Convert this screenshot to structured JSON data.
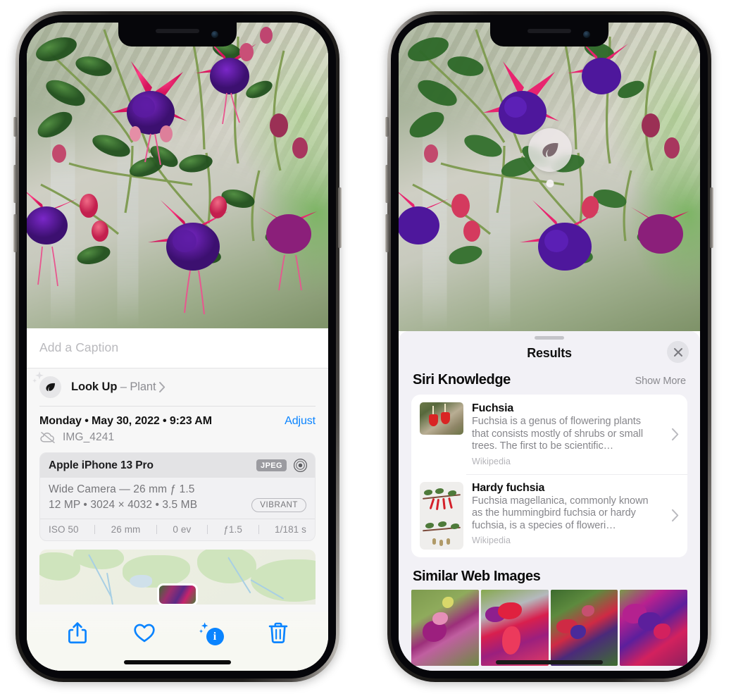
{
  "left_phone": {
    "caption_placeholder": "Add a Caption",
    "lookup": {
      "label": "Look Up",
      "separator": " – ",
      "subject": "Plant",
      "icon": "leaf-icon",
      "sparkle_icon": "sparkle-icon",
      "chevron_icon": "chevron-right-icon"
    },
    "meta": {
      "date": "Monday • May 30, 2022 • 9:23 AM",
      "adjust_label": "Adjust",
      "filename": "IMG_4241",
      "cloud_icon": "cloud-slash-icon"
    },
    "camera_card": {
      "device": "Apple iPhone 13 Pro",
      "format_badge": "JPEG",
      "aperture_icon": "aperture-icon",
      "lens_line": "Wide Camera — 26 mm ƒ 1.5",
      "specs_line": "12 MP • 3024 × 4032 • 3.5 MB",
      "style_pill": "VIBRANT",
      "exif": [
        "ISO 50",
        "26 mm",
        "0 ev",
        "ƒ1.5",
        "1/181 s"
      ]
    },
    "toolbar": [
      {
        "name": "share-button",
        "icon": "share-icon"
      },
      {
        "name": "favorite-button",
        "icon": "heart-icon"
      },
      {
        "name": "info-button",
        "icon": "info-sparkle-icon",
        "glyph": "i"
      },
      {
        "name": "delete-button",
        "icon": "trash-icon"
      }
    ],
    "accent_color": "#0a84ff"
  },
  "right_phone": {
    "leaf_badge_icon": "leaf-icon",
    "sheet": {
      "title": "Results",
      "close_icon": "close-icon",
      "grabber": "sheet-grabber"
    },
    "siri_knowledge": {
      "heading": "Siri Knowledge",
      "show_more": "Show More",
      "items": [
        {
          "title": "Fuchsia",
          "description": "Fuchsia is a genus of flowering plants that consists mostly of shrubs or small trees. The first to be scientific…",
          "source": "Wikipedia",
          "chevron_icon": "chevron-right-icon"
        },
        {
          "title": "Hardy fuchsia",
          "description": "Fuchsia magellanica, commonly known as the hummingbird fuchsia or hardy fuchsia, is a species of floweri…",
          "source": "Wikipedia",
          "chevron_icon": "chevron-right-icon"
        }
      ]
    },
    "similar_web_images": {
      "heading": "Similar Web Images",
      "count": 4
    }
  }
}
